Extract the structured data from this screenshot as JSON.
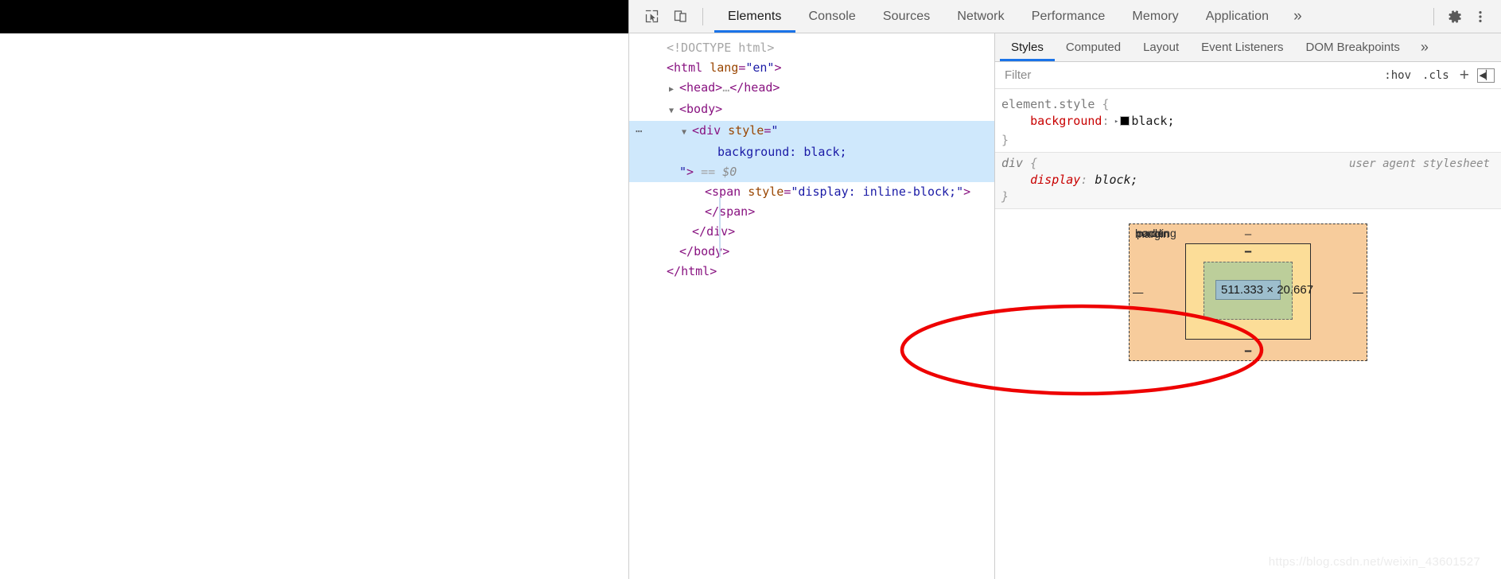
{
  "page": {
    "black_div_note": "black background div rendered in the page viewport"
  },
  "devtools": {
    "toolbar": {
      "inspect_icon": "cursor-select-icon",
      "device_toggle_icon": "device-toolbar-icon",
      "tabs": [
        {
          "label": "Elements",
          "active": true
        },
        {
          "label": "Console",
          "active": false
        },
        {
          "label": "Sources",
          "active": false
        },
        {
          "label": "Network",
          "active": false
        },
        {
          "label": "Performance",
          "active": false
        },
        {
          "label": "Memory",
          "active": false
        },
        {
          "label": "Application",
          "active": false
        }
      ],
      "more_tabs": "»",
      "settings_icon": "gear-icon",
      "menu_icon": "kebab-menu-icon"
    },
    "dom_tree": [
      {
        "indent": 1,
        "twisty": "",
        "badge": "",
        "selected": false,
        "tokens": [
          {
            "t": "doctype",
            "s": "<!DOCTYPE html>"
          }
        ]
      },
      {
        "indent": 1,
        "twisty": "",
        "badge": "",
        "selected": false,
        "tokens": [
          {
            "t": "pu",
            "s": "<"
          },
          {
            "t": "tw",
            "s": "html"
          },
          {
            "t": "sp",
            "s": " "
          },
          {
            "t": "at",
            "s": "lang"
          },
          {
            "t": "pu2",
            "s": "="
          },
          {
            "t": "av",
            "s": "\"en\""
          },
          {
            "t": "pu",
            "s": ">"
          }
        ]
      },
      {
        "indent": 2,
        "twisty": "▶",
        "badge": "",
        "selected": false,
        "tokens": [
          {
            "t": "pu",
            "s": "<"
          },
          {
            "t": "tw",
            "s": "head"
          },
          {
            "t": "pu",
            "s": ">"
          },
          {
            "t": "gray",
            "s": "…"
          },
          {
            "t": "pu",
            "s": "</"
          },
          {
            "t": "tw",
            "s": "head"
          },
          {
            "t": "pu",
            "s": ">"
          }
        ]
      },
      {
        "indent": 2,
        "twisty": "▼",
        "badge": "",
        "selected": false,
        "tokens": [
          {
            "t": "pu",
            "s": "<"
          },
          {
            "t": "tw",
            "s": "body"
          },
          {
            "t": "pu",
            "s": ">"
          }
        ]
      },
      {
        "indent": 3,
        "twisty": "▼",
        "badge": "⋯",
        "selected": true,
        "tokens": [
          {
            "t": "pu",
            "s": "<"
          },
          {
            "t": "tw",
            "s": "div"
          },
          {
            "t": "sp",
            "s": " "
          },
          {
            "t": "at",
            "s": "style"
          },
          {
            "t": "pu2",
            "s": "="
          },
          {
            "t": "av",
            "s": "\""
          }
        ]
      },
      {
        "indent": 5,
        "twisty": "",
        "badge": "",
        "selected": true,
        "tokens": [
          {
            "t": "av",
            "s": "background: black;"
          }
        ]
      },
      {
        "indent": 2,
        "twisty": "",
        "badge": "",
        "selected": true,
        "tokens": [
          {
            "t": "av",
            "s": "\""
          },
          {
            "t": "pu",
            "s": ">"
          },
          {
            "t": "sp",
            "s": " "
          },
          {
            "t": "gray",
            "s": "=="
          },
          {
            "t": "sp",
            "s": " "
          },
          {
            "t": "dollar",
            "s": "$0"
          }
        ]
      },
      {
        "indent": 4,
        "twisty": "",
        "badge": "",
        "selected": false,
        "tokens": [
          {
            "t": "pu",
            "s": "<"
          },
          {
            "t": "tw",
            "s": "span"
          },
          {
            "t": "sp",
            "s": " "
          },
          {
            "t": "at",
            "s": "style"
          },
          {
            "t": "pu2",
            "s": "="
          },
          {
            "t": "av",
            "s": "\"display: inline-block;\""
          },
          {
            "t": "pu",
            "s": ">"
          }
        ]
      },
      {
        "indent": 4,
        "twisty": "",
        "badge": "",
        "selected": false,
        "tokens": [
          {
            "t": "pu",
            "s": "</"
          },
          {
            "t": "tw",
            "s": "span"
          },
          {
            "t": "pu",
            "s": ">"
          }
        ]
      },
      {
        "indent": 3,
        "twisty": "",
        "badge": "",
        "selected": false,
        "tokens": [
          {
            "t": "pu",
            "s": "</"
          },
          {
            "t": "tw",
            "s": "div"
          },
          {
            "t": "pu",
            "s": ">"
          }
        ]
      },
      {
        "indent": 2,
        "twisty": "",
        "badge": "",
        "selected": false,
        "tokens": [
          {
            "t": "pu",
            "s": "</"
          },
          {
            "t": "tw",
            "s": "body"
          },
          {
            "t": "pu",
            "s": ">"
          }
        ]
      },
      {
        "indent": 1,
        "twisty": "",
        "badge": "",
        "selected": false,
        "tokens": [
          {
            "t": "pu",
            "s": "</"
          },
          {
            "t": "tw",
            "s": "html"
          },
          {
            "t": "pu",
            "s": ">"
          }
        ]
      }
    ],
    "styles": {
      "tabs": [
        {
          "label": "Styles",
          "active": true
        },
        {
          "label": "Computed",
          "active": false
        },
        {
          "label": "Layout",
          "active": false
        },
        {
          "label": "Event Listeners",
          "active": false
        },
        {
          "label": "DOM Breakpoints",
          "active": false
        }
      ],
      "more_tabs": "»",
      "filter_placeholder": "Filter",
      "filter_value": "",
      "hov_label": ":hov",
      "cls_label": ".cls",
      "new_rule_label": "+",
      "sidebar_toggle_icon": "panel-toggle-icon",
      "rules": [
        {
          "selector": "element.style",
          "origin": "",
          "ua": false,
          "declarations": [
            {
              "property": "background",
              "value": "black",
              "swatch": "#000000",
              "has_disclosure": true
            }
          ]
        },
        {
          "selector": "div",
          "origin": "user agent stylesheet",
          "ua": true,
          "declarations": [
            {
              "property": "display",
              "value": "block",
              "swatch": "",
              "has_disclosure": false
            }
          ]
        }
      ],
      "box_model": {
        "margin_label": "margin",
        "border_label": "border",
        "padding_label": "padding",
        "content_size": "511.333 × 20.667",
        "dash": "–",
        "colors": {
          "margin": "#f7cc9c",
          "border": "#fcdd98",
          "padding": "#bcce9a",
          "content": "#9dbecd"
        }
      }
    },
    "annotation": {
      "shape": "red-ellipse-highlight",
      "color": "#ee0000"
    }
  },
  "watermark": "https://blog.csdn.net/weixin_43601527"
}
